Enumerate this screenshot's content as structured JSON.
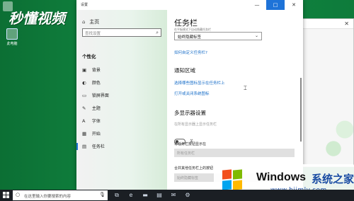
{
  "desktop": {
    "watermark_text": "秒懂视频",
    "icon_label": "此电脑"
  },
  "window": {
    "title": "设置",
    "minimize": "—",
    "maximize": "□",
    "close": "✕"
  },
  "nav": {
    "home_label": "主页",
    "search_placeholder": "查找设置",
    "section_title": "个性化",
    "items": [
      {
        "label": "背景",
        "icon": "image-icon"
      },
      {
        "label": "颜色",
        "icon": "palette-icon"
      },
      {
        "label": "锁屏界面",
        "icon": "lock-screen-icon"
      },
      {
        "label": "主题",
        "icon": "theme-icon"
      },
      {
        "label": "字体",
        "icon": "font-icon"
      },
      {
        "label": "开始",
        "icon": "start-icon"
      },
      {
        "label": "任务栏",
        "icon": "taskbar-icon"
      }
    ],
    "active_index": 6
  },
  "content": {
    "title": "任务栏",
    "hint_text": "在平板模式下自动隐藏任务栏",
    "dropdown_value": "始终隐藏标签",
    "link_customize": "如何自定义任务栏?",
    "notify_heading": "通知区域",
    "link_select_icons": "选择哪些图标显示在任务栏上",
    "link_system_icons": "打开或关闭系统图标",
    "multi_heading": "多显示器设置",
    "show_all_label": "在所有显示器上显示任务栏",
    "toggle_state": "关",
    "show_buttons_label": "将任务栏按钮显示在",
    "show_buttons_value": "所有任务栏",
    "combine_label": "合并其他任务栏上的按钮",
    "combine_value": "始终隐藏标签"
  },
  "taskbar": {
    "search_placeholder": "在这里输入你要搜索的内容"
  },
  "branding": {
    "name": "Windows",
    "cn_name": "系统之家",
    "url": "www.bjjmlv.com"
  }
}
